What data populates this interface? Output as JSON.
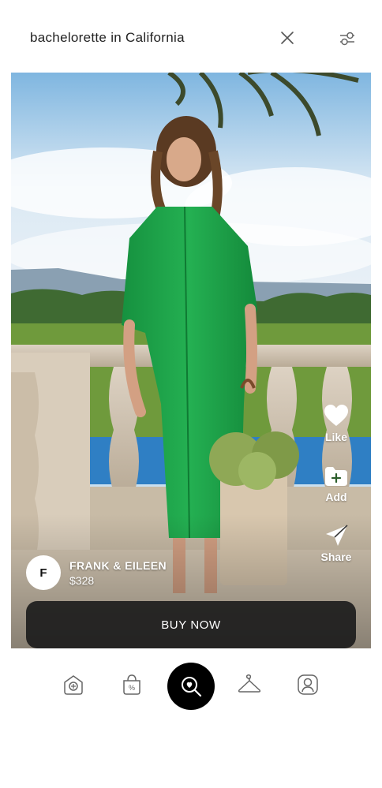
{
  "header": {
    "search_query": "bachelorette in California",
    "close_icon": "close-icon",
    "filter_icon": "filter-sliders-icon"
  },
  "product": {
    "brand_initial": "F",
    "brand_name": "FRANK & EILEEN",
    "price": "$328",
    "image_description_icon": "product-photo"
  },
  "actions": {
    "like_label": "Like",
    "add_label": "Add",
    "share_label": "Share"
  },
  "buy_button": {
    "label": "BUY NOW"
  },
  "bottom_nav": {
    "items": [
      {
        "icon": "shop-home-icon"
      },
      {
        "icon": "sale-bag-icon"
      },
      {
        "icon": "search-discover-icon",
        "active": true
      },
      {
        "icon": "hanger-icon"
      },
      {
        "icon": "profile-icon"
      }
    ]
  },
  "colors": {
    "dress_green": "#1fa34a",
    "buy_button_bg": "#1c1c1c",
    "nav_active_bg": "#000000"
  }
}
